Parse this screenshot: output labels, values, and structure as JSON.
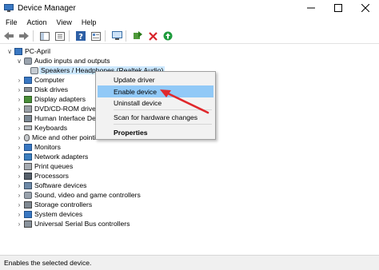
{
  "window": {
    "title": "Device Manager"
  },
  "menu": [
    "File",
    "Action",
    "View",
    "Help"
  ],
  "toolbar": {
    "buttons": [
      "back-icon",
      "forward-icon",
      "show-hide-console-tree-icon",
      "properties-icon",
      "help-icon",
      "details-icon",
      "scan-hardware-icon",
      "update-driver-icon",
      "uninstall-icon",
      "enable-device-icon"
    ]
  },
  "tree": {
    "root": "PC-April",
    "audio_category": "Audio inputs and outputs",
    "audio_device": "Speakers / Headphones (Realtek Audio)",
    "categories": [
      "Computer",
      "Disk drives",
      "Display adapters",
      "DVD/CD-ROM drives",
      "Human Interface Devi",
      "Keyboards",
      "Mice and other pointi",
      "Monitors",
      "Network adapters",
      "Print queues",
      "Processors",
      "Software devices",
      "Sound, video and game controllers",
      "Storage controllers",
      "System devices",
      "Universal Serial Bus controllers"
    ]
  },
  "context_menu": {
    "items": [
      "Update driver",
      "Enable device",
      "Uninstall device",
      "Scan for hardware changes",
      "Properties"
    ],
    "highlighted": "Enable device"
  },
  "status_bar": {
    "text": "Enables the selected device."
  },
  "colors": {
    "highlight": "#91c9f7",
    "selection": "#cce8ff",
    "annotation_arrow": "#e0282c"
  }
}
